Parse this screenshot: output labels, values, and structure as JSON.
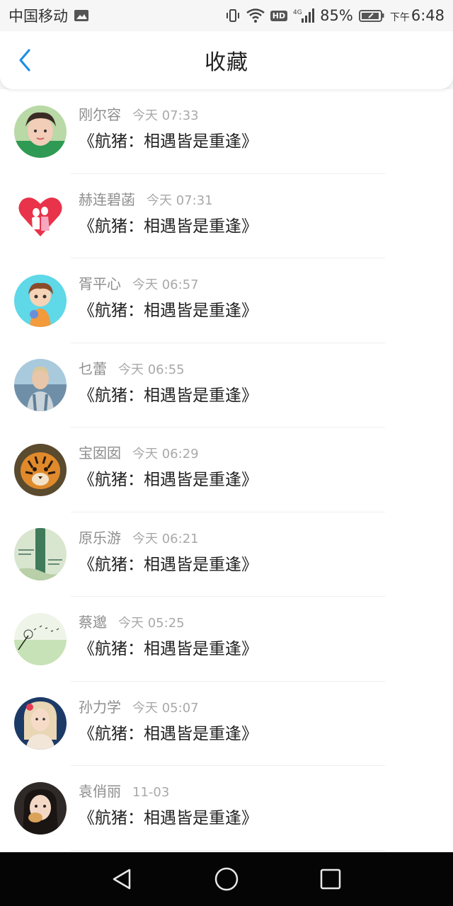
{
  "status_bar": {
    "carrier": "中国移动",
    "hd": "HD",
    "network": "4G",
    "battery": "85%",
    "ampm": "下午",
    "time": "6:48"
  },
  "header": {
    "title": "收藏",
    "back_icon": "chevron-left-icon",
    "accent_color": "#1e90e6"
  },
  "items": [
    {
      "user": "刚尔容",
      "time": "今天 07:33",
      "title": "《航猪：相遇皆是重逢》",
      "avatar": "girl-photo"
    },
    {
      "user": "赫连碧菡",
      "time": "今天 07:31",
      "title": "《航猪：相遇皆是重逢》",
      "avatar": "heart-couple"
    },
    {
      "user": "胥平心",
      "time": "今天 06:57",
      "title": "《航猪：相遇皆是重逢》",
      "avatar": "cartoon-boy"
    },
    {
      "user": "乜蕾",
      "time": "今天 06:55",
      "title": "《航猪：相遇皆是重逢》",
      "avatar": "beach-man"
    },
    {
      "user": "宝囡囡",
      "time": "今天 06:29",
      "title": "《航猪：相遇皆是重逢》",
      "avatar": "tiger"
    },
    {
      "user": "原乐游",
      "time": "今天 06:21",
      "title": "《航猪：相遇皆是重逢》",
      "avatar": "green-art"
    },
    {
      "user": "蔡邈",
      "time": "今天 05:25",
      "title": "《航猪：相遇皆是重逢》",
      "avatar": "dandelion"
    },
    {
      "user": "孙力学",
      "time": "今天 05:07",
      "title": "《航猪：相遇皆是重逢》",
      "avatar": "woman-portrait"
    },
    {
      "user": "袁俏丽",
      "time": "11-03",
      "title": "《航猪：相遇皆是重逢》",
      "avatar": "child-photo"
    }
  ],
  "system_nav": {
    "back_icon": "triangle-back-icon",
    "home_icon": "circle-home-icon",
    "recents_icon": "square-recents-icon"
  }
}
